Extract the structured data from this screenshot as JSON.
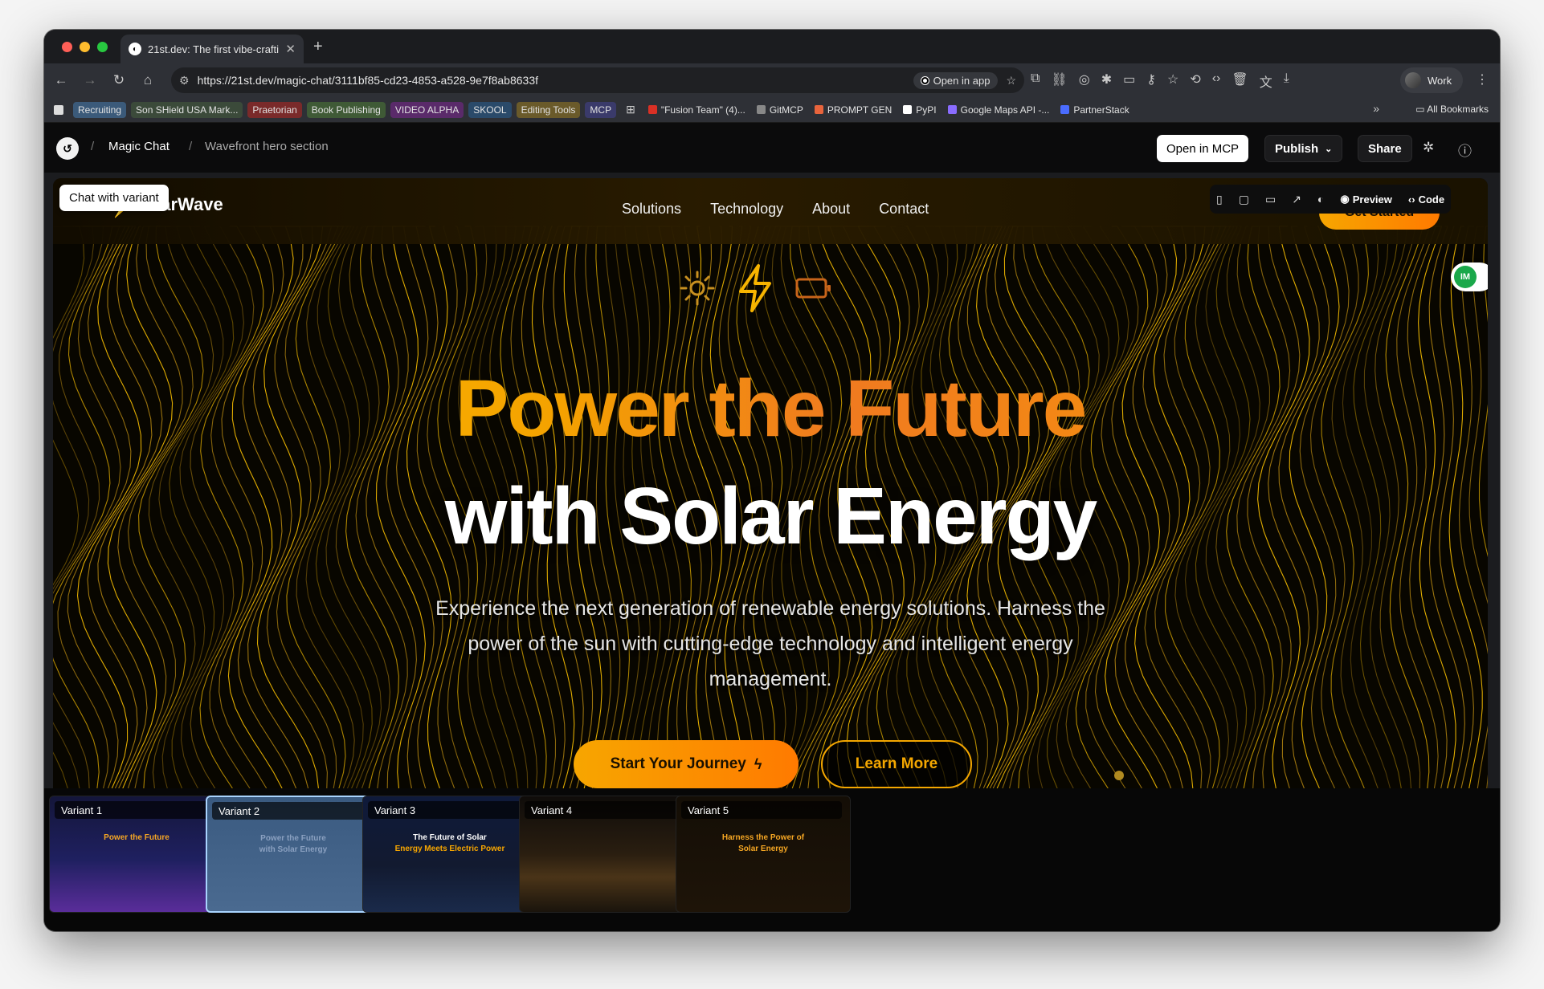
{
  "browser": {
    "tab_title": "21st.dev: The first vibe-craftin",
    "url": "https://21st.dev/magic-chat/3111bf85-cd23-4853-a528-9e7f8ab8633f",
    "open_in_app": "Open in app",
    "profile_name": "Work",
    "bookmarks": [
      {
        "label": "Recruiting",
        "color": "#3b5a7a"
      },
      {
        "label": "Son SHield USA Mark...",
        "color": "#3b4a3a"
      },
      {
        "label": "Praetorian",
        "color": "#7a2a2a"
      },
      {
        "label": "Book Publishing",
        "color": "#3f5a36"
      },
      {
        "label": "VIDEO ALPHA",
        "color": "#5a2a6a"
      },
      {
        "label": "SKOOL",
        "color": "#2a4a6a"
      },
      {
        "label": "Editing Tools",
        "color": "#6a5a2a"
      },
      {
        "label": "MCP",
        "color": "#3a3a6a"
      }
    ],
    "bookmarks_plain": [
      {
        "label": "\"Fusion Team\" (4)...",
        "icon": "gmail-icon",
        "color": "#d93025"
      },
      {
        "label": "GitMCP",
        "icon": "gitmcp-icon",
        "color": "#888888"
      },
      {
        "label": "PROMPT GEN",
        "icon": "sparkle-icon",
        "color": "#e8643c"
      },
      {
        "label": "PyPI",
        "icon": "pypi-icon",
        "color": "#ffffff"
      },
      {
        "label": "Google Maps API -...",
        "icon": "maps-icon",
        "color": "#8a6cff"
      },
      {
        "label": "PartnerStack",
        "icon": "partnerstack-icon",
        "color": "#4a6cff"
      }
    ],
    "all_bookmarks": "All Bookmarks"
  },
  "app": {
    "crumb_root": "Magic Chat",
    "crumb_current": "Wavefront hero section",
    "open_in_mcp": "Open in MCP",
    "publish": "Publish",
    "share": "Share"
  },
  "preview": {
    "chat_with_variant": "Chat with variant",
    "brand": "SolarWave",
    "nav": [
      "Solutions",
      "Technology",
      "About",
      "Contact"
    ],
    "get_started": "Get Started",
    "view_preview": "Preview",
    "view_code": "Code",
    "avatar_initials": "IM",
    "headline_1": "Power the Future",
    "headline_2": "with Solar Energy",
    "subtitle": "Experience the next generation of renewable energy solutions. Harness the power of the sun with cutting-edge technology and intelligent energy management.",
    "cta_primary": "Start Your Journey",
    "cta_secondary": "Learn More",
    "accent": "#f7a600"
  },
  "variants": [
    {
      "label": "Variant 1",
      "title_a": "Power the Future",
      "title_b": "",
      "bg": "linear-gradient(180deg,#14163a 0%,#1f2060 55%,#5a2d9a 100%)"
    },
    {
      "label": "Variant 2",
      "title_a": "Power the Future",
      "title_b": "with Solar Energy",
      "bg": "linear-gradient(180deg,#3a5a80 0%,#4a6a90 100%)"
    },
    {
      "label": "Variant 3",
      "title_a": "The Future of Solar",
      "title_b": "Energy Meets Electric Power",
      "bg": "linear-gradient(180deg,#0f1a3a 0%,#121a30 60%,#1a2a4a 100%)"
    },
    {
      "label": "Variant 4",
      "title_a": "",
      "title_b": "",
      "bg": "linear-gradient(180deg,#0f0c0a 0%,#2a1e10 50%,#4a3418 70%,#1a140c 100%)"
    },
    {
      "label": "Variant 5",
      "title_a": "Harness the Power of",
      "title_b": "Solar Energy",
      "bg": "linear-gradient(180deg,#140e06 0%,#1e1408 100%)"
    }
  ]
}
